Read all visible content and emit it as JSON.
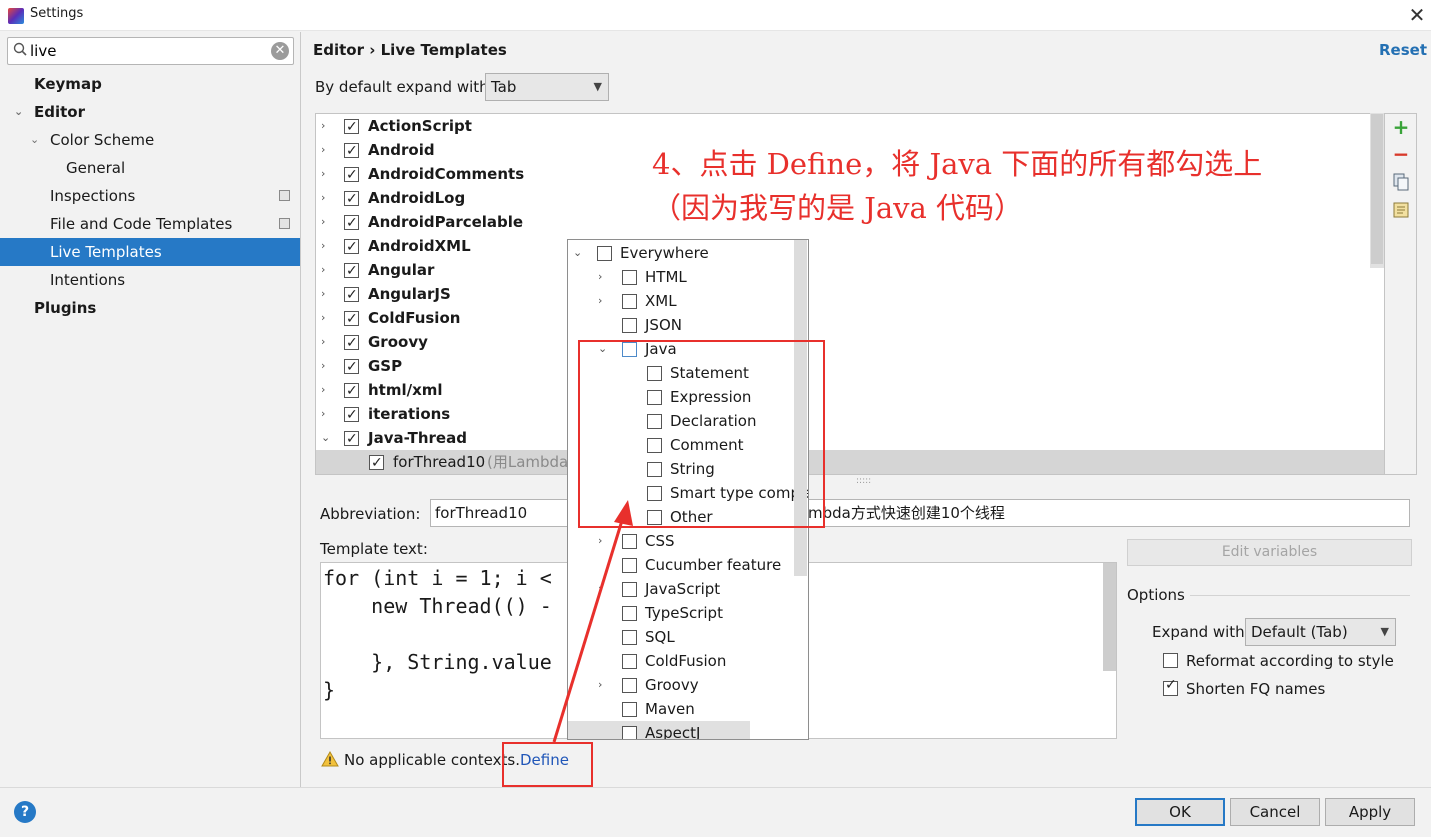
{
  "window": {
    "title": "Settings"
  },
  "sidebar": {
    "search_value": "live",
    "items": [
      {
        "label": "Keymap"
      },
      {
        "label": "Editor"
      },
      {
        "label": "Color Scheme"
      },
      {
        "label": "General"
      },
      {
        "label": "Inspections"
      },
      {
        "label": "File and Code Templates"
      },
      {
        "label": "Live Templates"
      },
      {
        "label": "Intentions"
      },
      {
        "label": "Plugins"
      }
    ]
  },
  "header": {
    "breadcrumb": "Editor › Live Templates",
    "reset_label": "Reset"
  },
  "expand_default": {
    "label": "By default expand with",
    "value": "Tab"
  },
  "tree": {
    "groups": [
      {
        "name": "ActionScript"
      },
      {
        "name": "Android"
      },
      {
        "name": "AndroidComments"
      },
      {
        "name": "AndroidLog"
      },
      {
        "name": "AndroidParcelable"
      },
      {
        "name": "AndroidXML"
      },
      {
        "name": "Angular"
      },
      {
        "name": "AngularJS"
      },
      {
        "name": "ColdFusion"
      },
      {
        "name": "Groovy"
      },
      {
        "name": "GSP"
      },
      {
        "name": "html/xml"
      },
      {
        "name": "iterations"
      },
      {
        "name": "Java-Thread"
      }
    ],
    "selected_template": {
      "name": "forThread10",
      "description": "(用Lambda方"
    }
  },
  "annotation": {
    "text": "4、点击 Define，将 Java 下面的所有都勾选上\n（因为我写的是 Java 代码）"
  },
  "editor": {
    "abbreviation_label": "Abbreviation:",
    "abbreviation_value": "forThread10",
    "description_value": "mbda方式快速创建10个线程",
    "template_text_label": "Template text:",
    "code_lines": [
      "for (int i = 1; i <",
      "    new Thread(() -",
      "",
      "    }, String.value",
      "}"
    ],
    "edit_variables_label": "Edit variables"
  },
  "options": {
    "title": "Options",
    "expand_with_label": "Expand with",
    "expand_with_value": "Default (Tab)",
    "reformat_label": "Reformat according to style",
    "reformat_checked": false,
    "shorten_label": "Shorten FQ names",
    "shorten_checked": true
  },
  "warning": {
    "text": "No applicable contexts.",
    "define_label": "Define"
  },
  "contexts": [
    {
      "label": "Everywhere",
      "level": 0,
      "expander": "open"
    },
    {
      "label": "HTML",
      "level": 1,
      "expander": "closed"
    },
    {
      "label": "XML",
      "level": 1,
      "expander": "closed"
    },
    {
      "label": "JSON",
      "level": 1,
      "expander": "none"
    },
    {
      "label": "Java",
      "level": 1,
      "expander": "open"
    },
    {
      "label": "Statement",
      "level": 2,
      "expander": "none"
    },
    {
      "label": "Expression",
      "level": 2,
      "expander": "none"
    },
    {
      "label": "Declaration",
      "level": 2,
      "expander": "none"
    },
    {
      "label": "Comment",
      "level": 2,
      "expander": "none"
    },
    {
      "label": "String",
      "level": 2,
      "expander": "none"
    },
    {
      "label": "Smart type completion",
      "level": 2,
      "expander": "none"
    },
    {
      "label": "Other",
      "level": 2,
      "expander": "none"
    },
    {
      "label": "CSS",
      "level": 1,
      "expander": "closed"
    },
    {
      "label": "Cucumber feature",
      "level": 1,
      "expander": "none"
    },
    {
      "label": "JavaScript",
      "level": 1,
      "expander": "closed"
    },
    {
      "label": "TypeScript",
      "level": 1,
      "expander": "none"
    },
    {
      "label": "SQL",
      "level": 1,
      "expander": "none"
    },
    {
      "label": "ColdFusion",
      "level": 1,
      "expander": "none"
    },
    {
      "label": "Groovy",
      "level": 1,
      "expander": "closed"
    },
    {
      "label": "Maven",
      "level": 1,
      "expander": "none"
    },
    {
      "label": "AspectJ",
      "level": 1,
      "expander": "none"
    }
  ],
  "buttons": {
    "ok": "OK",
    "cancel": "Cancel",
    "apply": "Apply",
    "help": "?"
  },
  "colors": {
    "accent": "#2679c6",
    "annotation": "#e8302c",
    "link": "#2056b8"
  },
  "icons": [
    "search-icon",
    "clear-icon",
    "close-icon",
    "add-icon",
    "remove-icon",
    "copy-icon",
    "notes-icon",
    "warning-icon",
    "help-icon"
  ]
}
